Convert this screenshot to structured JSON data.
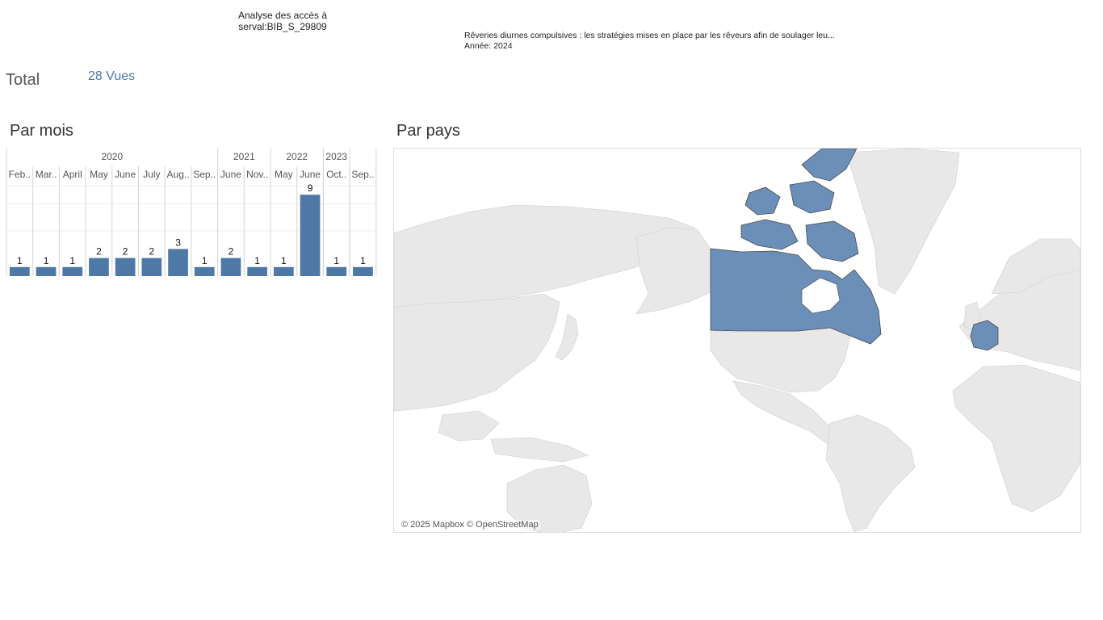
{
  "header": {
    "title_line1": "Analyse des accès à",
    "title_line2": "serval:BIB_S_29809"
  },
  "document": {
    "title": "Rêveries diurnes compulsives : les stratégies mises en place par les rêveurs afin de soulager leu...",
    "year_label": "Année: 2024"
  },
  "total": {
    "label": "Total",
    "value": "28 Vues"
  },
  "sections": {
    "monthly_title": "Par mois",
    "country_title": "Par pays"
  },
  "chart_data": {
    "type": "bar",
    "years": [
      {
        "label": "2020",
        "months": 8
      },
      {
        "label": "2021",
        "months": 2
      },
      {
        "label": "2022",
        "months": 2
      },
      {
        "label": "2023",
        "months": 1
      }
    ],
    "categories": [
      "Feb..",
      "Mar..",
      "April",
      "May",
      "June",
      "July",
      "Aug..",
      "Sep..",
      "June",
      "Nov..",
      "May",
      "June",
      "Oct..",
      "Sep.."
    ],
    "values": [
      1,
      1,
      1,
      2,
      2,
      2,
      3,
      1,
      2,
      1,
      1,
      9,
      1,
      1
    ],
    "ylim": [
      0,
      10
    ],
    "bar_color": "#4e79a7",
    "grid": true
  },
  "map": {
    "highlighted_countries": [
      "Canada",
      "France"
    ],
    "highlight_color": "#4e79a7",
    "land_color": "#e8e8e8",
    "attribution": "© 2025 Mapbox © OpenStreetMap"
  }
}
